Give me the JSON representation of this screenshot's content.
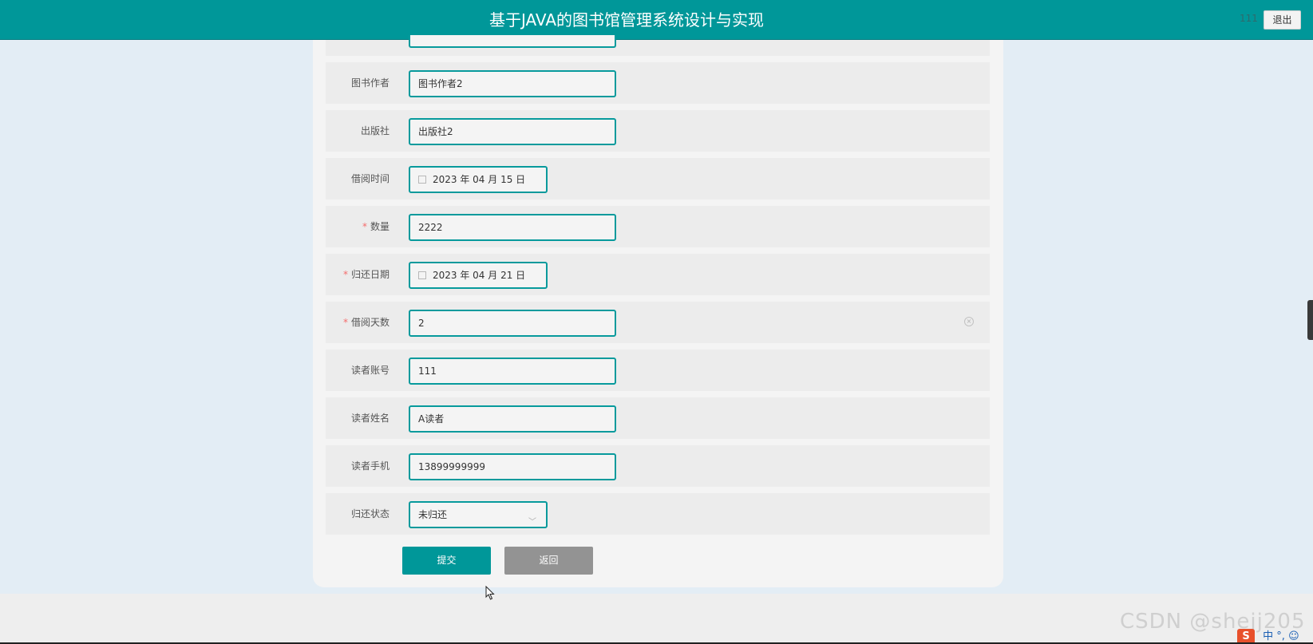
{
  "header": {
    "title": "基于JAVA的图书馆管理系统设计与实现",
    "username": "111",
    "logout_label": "退出"
  },
  "form": {
    "rows": [
      {
        "label": "图书作者",
        "required": false,
        "value": "图书作者2",
        "type": "text"
      },
      {
        "label": "出版社",
        "required": false,
        "value": "出版社2",
        "type": "text"
      },
      {
        "label": "借阅时间",
        "required": false,
        "value": "2023 年 04 月 15 日",
        "type": "date"
      },
      {
        "label": "数量",
        "required": true,
        "value": "2222",
        "type": "text"
      },
      {
        "label": "归还日期",
        "required": true,
        "value": "2023 年 04 月 21 日",
        "type": "date"
      },
      {
        "label": "借阅天数",
        "required": true,
        "value": "2",
        "type": "number"
      },
      {
        "label": "读者账号",
        "required": false,
        "value": "111",
        "type": "text"
      },
      {
        "label": "读者姓名",
        "required": false,
        "value": "A读者",
        "type": "text"
      },
      {
        "label": "读者手机",
        "required": false,
        "value": "13899999999",
        "type": "text"
      },
      {
        "label": "归还状态",
        "required": false,
        "value": "未归还",
        "type": "select"
      }
    ],
    "required_mark": "*",
    "submit_label": "提交",
    "back_label": "返回"
  },
  "watermark": "CSDN @shejj205",
  "tray": {
    "ime_label": "中",
    "punct_label": "°,",
    "logo_label": "S"
  },
  "icons": {
    "calendar": "calendar-icon",
    "select": "chevron-down-icon",
    "clear": "clear-circle-icon"
  },
  "colors": {
    "primary": "#009799",
    "input_border": "#079a9c",
    "back_button": "#939393",
    "required": "#f56c6c"
  }
}
